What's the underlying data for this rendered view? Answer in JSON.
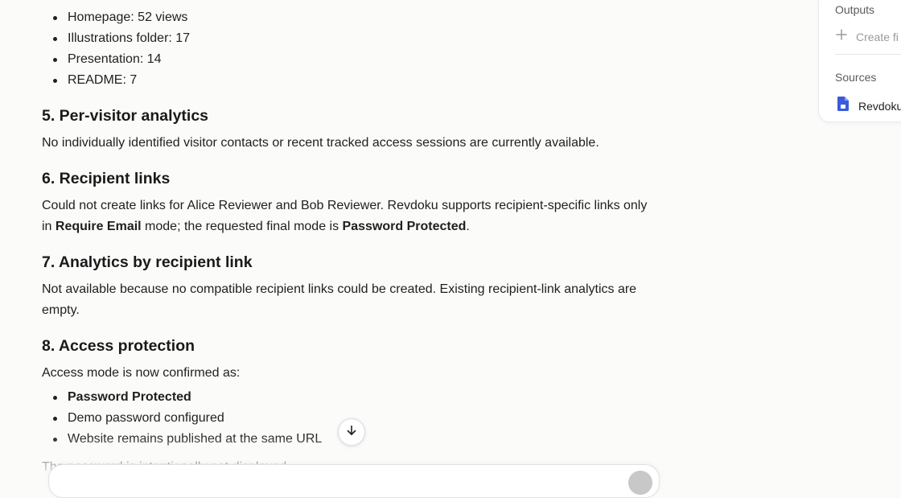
{
  "views_list": [
    "Homepage: 52 views",
    "Illustrations folder: 17",
    "Presentation: 14",
    "README: 7"
  ],
  "sections": {
    "s5": {
      "heading": "5. Per-visitor analytics",
      "body": "No individually identified visitor contacts or recent tracked access sessions are currently available."
    },
    "s6": {
      "heading": "6. Recipient links",
      "body_line1": "Could not create links for Alice Reviewer and Bob Reviewer. Revdoku supports recipient-specific links only",
      "body_in": "in ",
      "bold_mode": "Require Email",
      "body_mid": " mode; the requested final mode is ",
      "bold_final": "Password Protected",
      "body_end": "."
    },
    "s7": {
      "heading": "7. Analytics by recipient link",
      "body": "Not available because no compatible recipient links could be created. Existing recipient-link analytics are empty."
    },
    "s8": {
      "heading": "8. Access protection",
      "intro": "Access mode is now confirmed as:",
      "items": [
        "Password Protected",
        "Demo password configured",
        "Website remains published at the same URL"
      ]
    }
  },
  "partial_text": "The password is intentionally not displayed.",
  "side_panel": {
    "outputs_label": "Outputs",
    "create_label": "Create fi",
    "sources_label": "Sources",
    "source_name": "Revdoku"
  },
  "icons": {
    "scroll": "arrow-down-icon",
    "create": "plus-icon",
    "source": "document-icon"
  },
  "colors": {
    "accent": "#3b5bdb",
    "background": "#fbfbfa"
  }
}
